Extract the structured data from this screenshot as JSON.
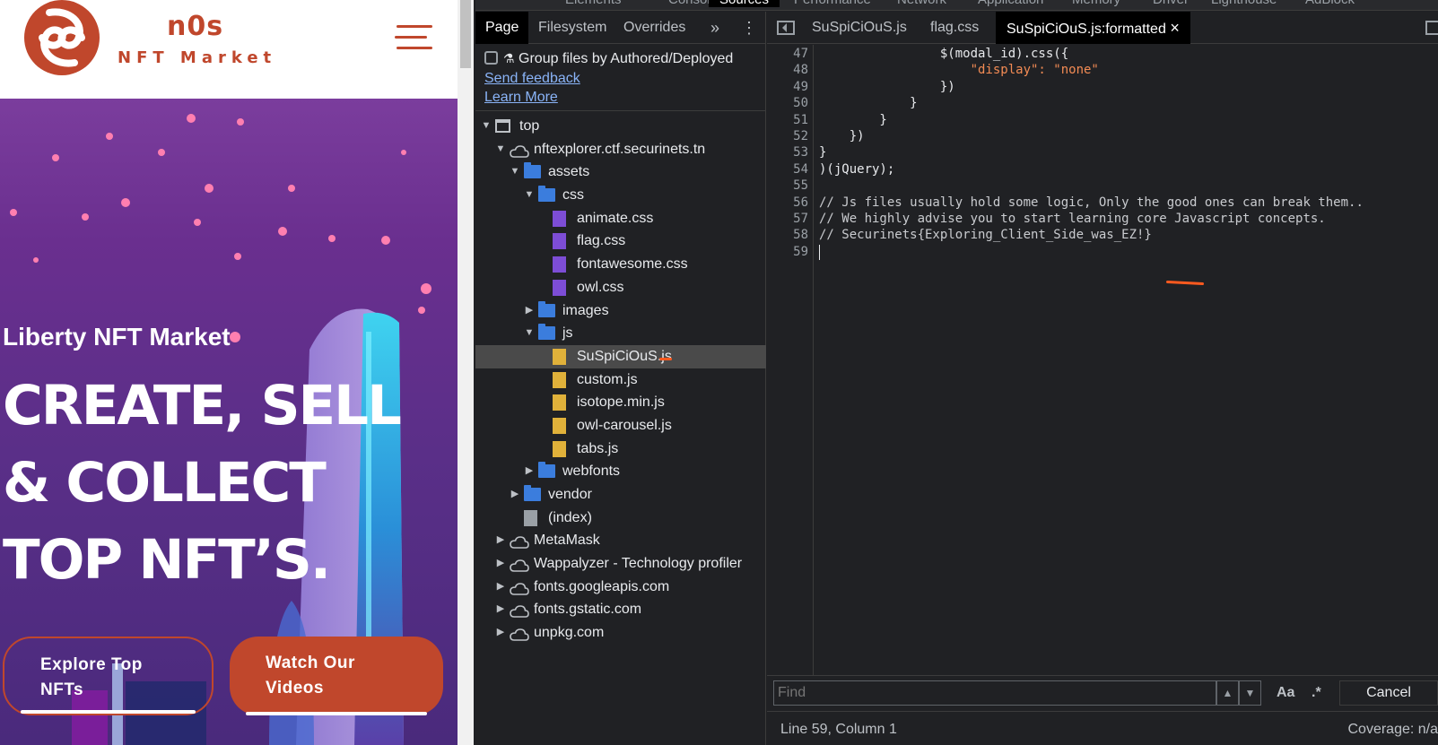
{
  "site": {
    "logo_text": "n0s",
    "logo_subtitle": "NFT Market",
    "hero_eyebrow": "Liberty NFT Market",
    "hero_title": "CREATE, SELL & COLLECT TOP NFT’S.",
    "btn_explore_line1": "Explore Top",
    "btn_explore_line2": "NFTs",
    "btn_watch_line1": "Watch Our",
    "btn_watch_line2": "Videos",
    "colors": {
      "brand": "#c0472c",
      "hero_bg": "#5a2f88"
    }
  },
  "devtools": {
    "panel_tabs": [
      "Elements",
      "Console",
      "Sources",
      "Performance",
      "Network",
      "Application",
      "Memory",
      "Driver",
      "Lighthouse",
      "AdBlock"
    ],
    "active_panel": "Sources",
    "navigator": {
      "tabs": [
        "Page",
        "Filesystem",
        "Overrides"
      ],
      "more": "»",
      "menu": "⋮",
      "group_label": "Group files by Authored/Deployed",
      "send_feedback": "Send feedback",
      "learn_more": "Learn More",
      "tree": [
        {
          "label": "top",
          "icon": "frame-icon"
        },
        {
          "label": "nftexplorer.ctf.securinets.tn",
          "icon": "cloud-icon"
        },
        {
          "label": "assets",
          "icon": "folder-icon"
        },
        {
          "label": "css",
          "icon": "folder-icon"
        },
        {
          "label": "animate.css",
          "icon": "css-file-icon"
        },
        {
          "label": "flag.css",
          "icon": "css-file-icon"
        },
        {
          "label": "fontawesome.css",
          "icon": "css-file-icon"
        },
        {
          "label": "owl.css",
          "icon": "css-file-icon"
        },
        {
          "label": "images",
          "icon": "folder-icon"
        },
        {
          "label": "js",
          "icon": "folder-icon"
        },
        {
          "label": "SuSpiCiOuS.js",
          "icon": "js-file-icon",
          "selected": true
        },
        {
          "label": "custom.js",
          "icon": "js-file-icon"
        },
        {
          "label": "isotope.min.js",
          "icon": "js-file-icon"
        },
        {
          "label": "owl-carousel.js",
          "icon": "js-file-icon"
        },
        {
          "label": "tabs.js",
          "icon": "js-file-icon"
        },
        {
          "label": "webfonts",
          "icon": "folder-icon"
        },
        {
          "label": "vendor",
          "icon": "folder-icon"
        },
        {
          "label": "(index)",
          "icon": "document-icon"
        },
        {
          "label": "MetaMask",
          "icon": "cloud-icon"
        },
        {
          "label": "Wappalyzer - Technology profiler",
          "icon": "cloud-icon"
        },
        {
          "label": "fonts.googleapis.com",
          "icon": "cloud-icon"
        },
        {
          "label": "fonts.gstatic.com",
          "icon": "cloud-icon"
        },
        {
          "label": "unpkg.com",
          "icon": "cloud-icon"
        }
      ]
    },
    "editor": {
      "tabs": [
        "SuSpiCiOuS.js",
        "flag.css",
        "SuSpiCiOuS.js:formatted"
      ],
      "active_tab": "SuSpiCiOuS.js:formatted",
      "close_glyph": "×",
      "lines": [
        {
          "n": "47",
          "text": "                $(modal_id).css({"
        },
        {
          "n": "48",
          "text": "                    \"display\": \"none\""
        },
        {
          "n": "49",
          "text": "                })"
        },
        {
          "n": "50",
          "text": "            }"
        },
        {
          "n": "51",
          "text": "        }"
        },
        {
          "n": "52",
          "text": "    })"
        },
        {
          "n": "53",
          "text": "}"
        },
        {
          "n": "54",
          "text": ")(jQuery);"
        },
        {
          "n": "55",
          "text": ""
        },
        {
          "n": "56",
          "text": "// Js files usually hold some logic, Only the good ones can break them.."
        },
        {
          "n": "57",
          "text": "// We highly advise you to start learning core Javascript concepts."
        },
        {
          "n": "58",
          "text": "// Securinets{Exploring_Client_Side_was_EZ!}"
        },
        {
          "n": "59",
          "text": ""
        }
      ],
      "find_placeholder": "Find",
      "find_up": "▲",
      "find_down": "▼",
      "find_case": "Aa",
      "find_regex": ".*",
      "find_cancel": "Cancel",
      "status_position": "Line 59, Column 1",
      "status_coverage": "Coverage: n/a"
    }
  }
}
